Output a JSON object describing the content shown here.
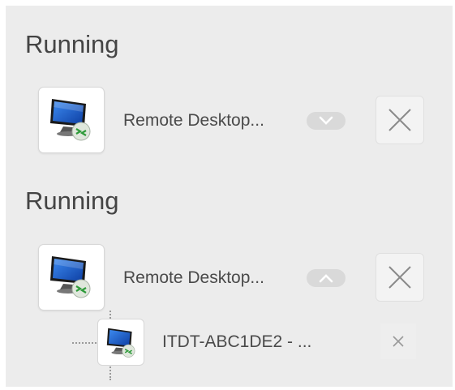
{
  "groups": [
    {
      "title": "Running",
      "app": {
        "icon": "remote-desktop-icon",
        "label": "Remote Desktop...",
        "toggle_icon": "chevron-down-icon",
        "close_icon": "close-icon"
      }
    },
    {
      "title": "Running",
      "app": {
        "icon": "remote-desktop-icon",
        "label": "Remote Desktop...",
        "toggle_icon": "chevron-up-icon",
        "close_icon": "close-icon"
      },
      "children": [
        {
          "icon": "remote-desktop-icon",
          "label": "ITDT-ABC1DE2 - ...",
          "close_icon": "close-icon"
        }
      ]
    }
  ],
  "colors": {
    "panel_bg": "#ececec",
    "text": "#4a4a4a",
    "monitor_blue": "#1f5fd0",
    "badge_green": "#4caf50"
  }
}
